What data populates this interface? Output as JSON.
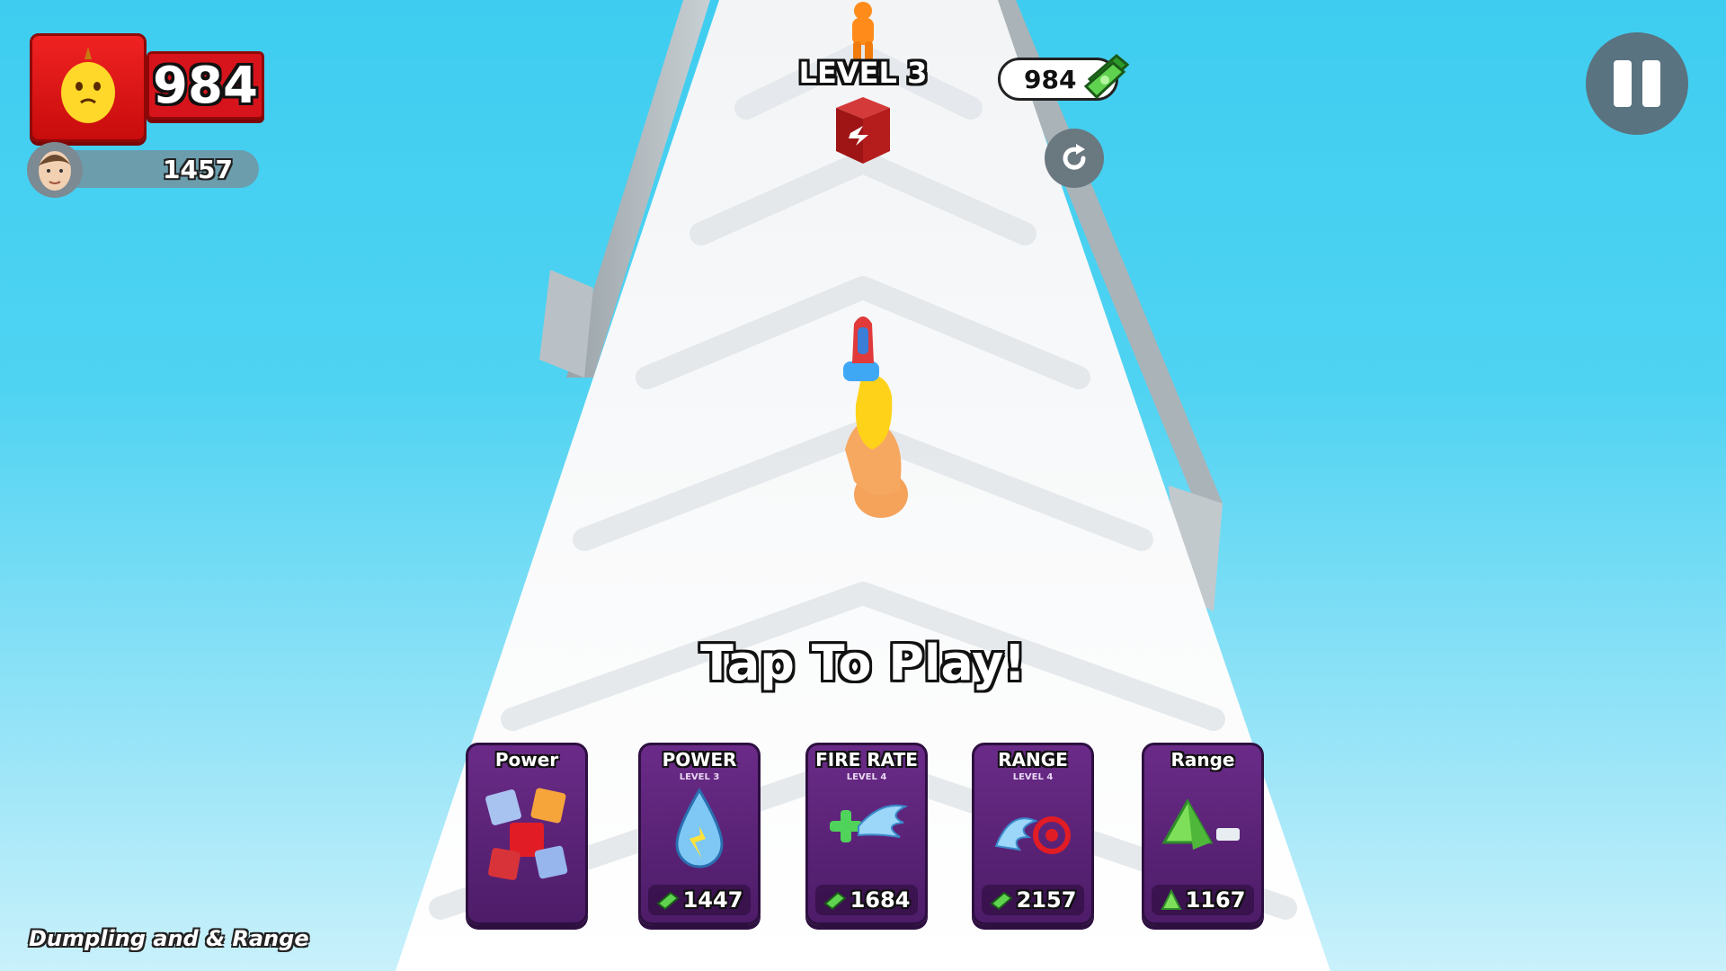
{
  "hud": {
    "fruit_score": "984",
    "player_score": "1457",
    "level_label": "LEVEL 3",
    "cash": "984"
  },
  "prompt": {
    "tap_to_play": "Tap To Play!"
  },
  "upgrades": [
    {
      "title": "Power",
      "subtitle": "",
      "price": "",
      "icon": "cubes-icon"
    },
    {
      "title": "POWER",
      "subtitle": "LEVEL 3",
      "price": "1447",
      "icon": "water-drop-icon"
    },
    {
      "title": "FIRE RATE",
      "subtitle": "LEVEL 4",
      "price": "1684",
      "icon": "water-splash-icon"
    },
    {
      "title": "RANGE",
      "subtitle": "LEVEL 4",
      "price": "2157",
      "icon": "target-splash-icon"
    },
    {
      "title": "Range",
      "subtitle": "",
      "price": "1167",
      "icon": "pyramid-icon"
    }
  ],
  "watermark": "Dumpling and & Range",
  "colors": {
    "sky_top": "#3ecdf0",
    "sky_bottom": "#c9f1fb",
    "card_purple": "#6a2b88",
    "fruit_red": "#e8191f",
    "cash_green": "#3fb83a"
  }
}
